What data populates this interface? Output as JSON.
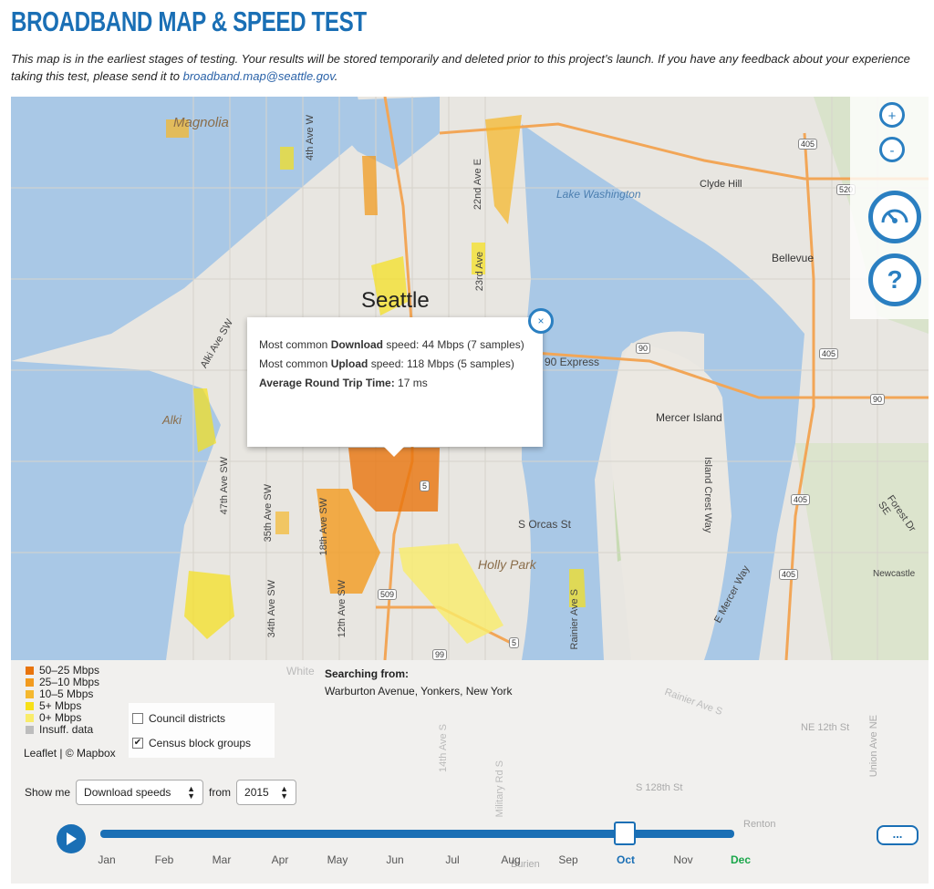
{
  "header": {
    "title": "BROADBAND MAP & SPEED TEST",
    "intro_text": "This map is in the earliest stages of testing. Your results will be stored temporarily and deleted prior to this project’s launch. If you have any feedback about your experience taking this test, please send it to ",
    "feedback_email": "broadband.map@seattle.gov",
    "intro_end": "."
  },
  "map": {
    "labels": {
      "magnolia": "Magnolia",
      "seattle": "Seattle",
      "lake_washington": "Lake Washington",
      "clyde_hill": "Clyde Hill",
      "bellevue": "Bellevue",
      "mercer_island": "Mercer Island",
      "alki": "Alki",
      "holly_park": "Holly Park",
      "s_orcas_st": "S Orcas St",
      "newcastle": "Newcastle",
      "i90_express": "90 Express",
      "4th_ave_w": "4th Ave W",
      "22nd_ave_e": "22nd Ave E",
      "23rd_ave": "23rd Ave",
      "alki_ave_sw": "Alki Ave SW",
      "47th_ave_sw": "47th Ave SW",
      "35th_ave_sw": "35th Ave SW",
      "34th_ave_sw": "34th Ave SW",
      "18th_ave_sw": "18th Ave SW",
      "12th_ave_sw": "12th Ave SW",
      "island_crest_way": "Island Crest Way",
      "e_mercer_way": "E Mercer Way",
      "rainier_ave_s": "Rainier Ave S",
      "forest_dr_se": "Forest Dr SE"
    },
    "shields": [
      "405",
      "520",
      "90",
      "405",
      "90",
      "405",
      "405",
      "509",
      "99",
      "5",
      "5"
    ],
    "zoom_in_label": "+",
    "zoom_out_label": "-",
    "help_label": "?",
    "popup": {
      "line1_prefix": "Most common ",
      "line1_bold": "Download",
      "line1_suffix": " speed: 44 Mbps (7 samples)",
      "line2_prefix": "Most common ",
      "line2_bold": "Upload",
      "line2_suffix": " speed: 118 Mbps (5 samples)",
      "line3_bold": "Average Round Trip Time:",
      "line3_suffix": " 17 ms",
      "close_label": "×"
    }
  },
  "legend": {
    "items": [
      {
        "label": "50–25 Mbps",
        "color": "#e8740c"
      },
      {
        "label": "25–10 Mbps",
        "color": "#f29b1f"
      },
      {
        "label": "10–5 Mbps",
        "color": "#f5b82e"
      },
      {
        "label": "5+ Mbps",
        "color": "#f7e018"
      },
      {
        "label": "0+ Mbps",
        "color": "#f9ec6a"
      },
      {
        "label": "Insuff. data",
        "color": "#bdbdbd"
      }
    ],
    "attribution": "Leaflet | © Mapbox"
  },
  "layers": {
    "council_districts": {
      "label": "Council districts",
      "checked": false
    },
    "census_block_groups": {
      "label": "Census block groups",
      "checked": true
    }
  },
  "searching": {
    "label": "Searching from:",
    "location": "Warburton Avenue, Yonkers, New York"
  },
  "lower_map_labels": {
    "white": "White",
    "rainier_ave_s": "Rainier Ave S",
    "ne_12th_st": "NE 12th St",
    "union_ave_ne": "Union Ave NE",
    "s_128th_st": "S 128th St",
    "renton": "Renton",
    "burien": "Burien",
    "14th_ave_s": "14th Ave S",
    "military_rd_s": "Military Rd S"
  },
  "controls": {
    "show_me_label": "Show me",
    "metric_value": "Download speeds",
    "from_label": "from",
    "year_value": "2015",
    "more_label": "...",
    "months": [
      "Jan",
      "Feb",
      "Mar",
      "Apr",
      "May",
      "Jun",
      "Jul",
      "Aug",
      "Sep",
      "Oct",
      "Nov",
      "Dec"
    ],
    "selected_month": "Oct",
    "current_month": "Dec",
    "slider_position_fraction": 0.82,
    "accent_color": "#1a6fb5",
    "current_color": "#1aa64a"
  }
}
